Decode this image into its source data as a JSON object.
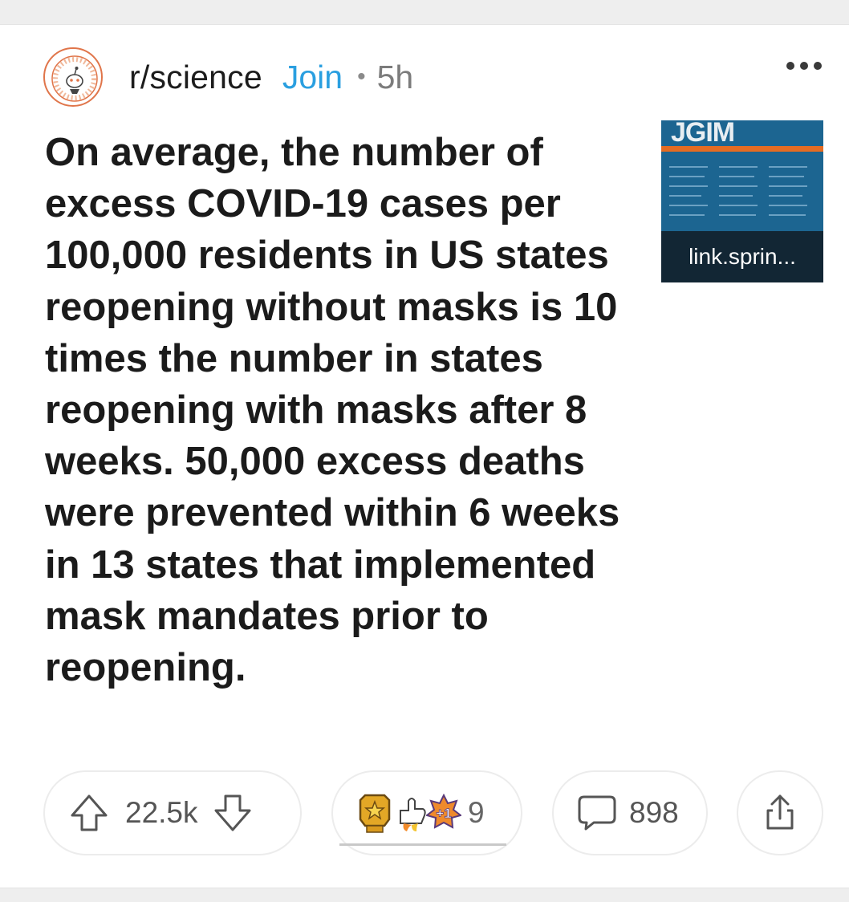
{
  "post": {
    "subreddit": "r/science",
    "join_label": "Join",
    "separator": "•",
    "age": "5h",
    "title": "On average, the number of excess COVID-19 cases per 100,000 residents in US states reopening without masks is 10 times the number in states reopening with masks after 8 weeks. 50,000 excess deaths were prevented within 6 weeks in 13 states that implemented mask mandates prior to reopening.",
    "thumbnail": {
      "brand": "JGIM",
      "domain": "link.sprin..."
    },
    "score": "22.5k",
    "award_count": "9",
    "comment_count": "898"
  },
  "icons": {
    "avatar": "subreddit-science-icon",
    "more": "more-options-icon",
    "upvote": "upvote-arrow-icon",
    "downvote": "downvote-arrow-icon",
    "awards": [
      "gold-award-icon",
      "thumbs-up-rocket-award-icon",
      "plus-one-award-icon"
    ],
    "comment": "comment-bubble-icon",
    "share": "share-icon"
  },
  "colors": {
    "join": "#2a9fe0",
    "thumb_bg": "#1c6591",
    "thumb_stripe": "#e56c22",
    "avatar_ring": "#e0754a"
  }
}
